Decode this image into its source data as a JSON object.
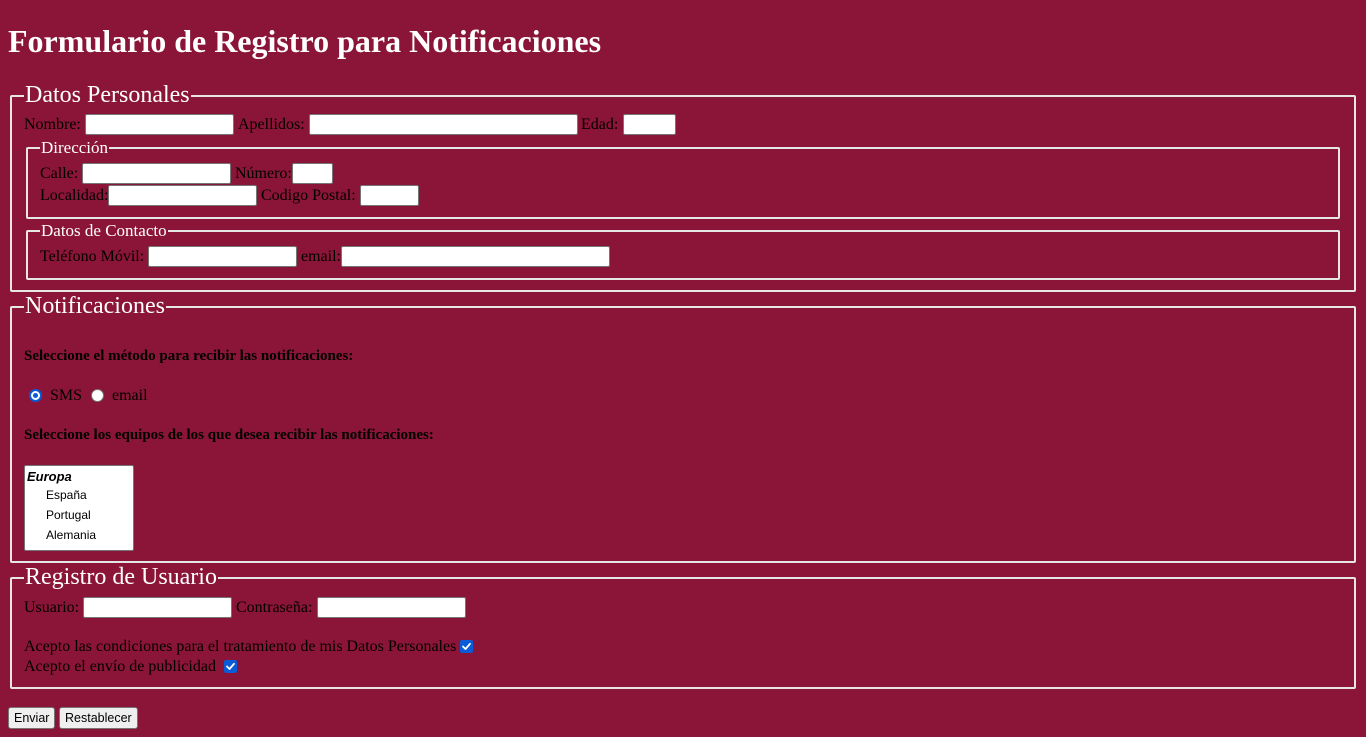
{
  "page": {
    "title": "Formulario de Registro para Notificaciones",
    "background_color": "#8b1538"
  },
  "personal": {
    "legend": "Datos Personales",
    "nombre_label": "Nombre:",
    "nombre_value": "",
    "apellidos_label": "Apellidos:",
    "apellidos_value": "",
    "edad_label": "Edad:",
    "edad_value": "",
    "direccion": {
      "legend": "Dirección",
      "calle_label": "Calle:",
      "calle_value": "",
      "numero_label": "Número:",
      "numero_value": "",
      "localidad_label": "Localidad:",
      "localidad_value": "",
      "cp_label": "Codigo Postal:",
      "cp_value": ""
    },
    "contacto": {
      "legend": "Datos de Contacto",
      "movil_label": "Teléfono Móvil:",
      "movil_value": "",
      "email_label": "email:",
      "email_value": ""
    }
  },
  "notificaciones": {
    "legend": "Notificaciones",
    "metodo_prompt": "Seleccione el método para recibir las notificaciones:",
    "methods": [
      {
        "label": "SMS",
        "checked": true
      },
      {
        "label": "email",
        "checked": false
      }
    ],
    "equipos_prompt": "Seleccione los equipos de los que desea recibir las notificaciones:",
    "equipos_group": "Europa",
    "equipos_options": [
      "España",
      "Portugal",
      "Alemania"
    ]
  },
  "registro": {
    "legend": "Registro de Usuario",
    "usuario_label": "Usuario:",
    "usuario_value": "",
    "password_label": "Contraseña:",
    "password_value": "",
    "acepto_datos_label": "Acepto las condiciones para el tratamiento de mis Datos Personales",
    "acepto_datos_checked": true,
    "acepto_publicidad_label": "Acepto el envío de publicidad",
    "acepto_publicidad_checked": true
  },
  "buttons": {
    "submit_label": "Enviar",
    "reset_label": "Restablecer"
  },
  "colors": {
    "accent": "#0a5bd7",
    "border": "#e6e6e6"
  }
}
